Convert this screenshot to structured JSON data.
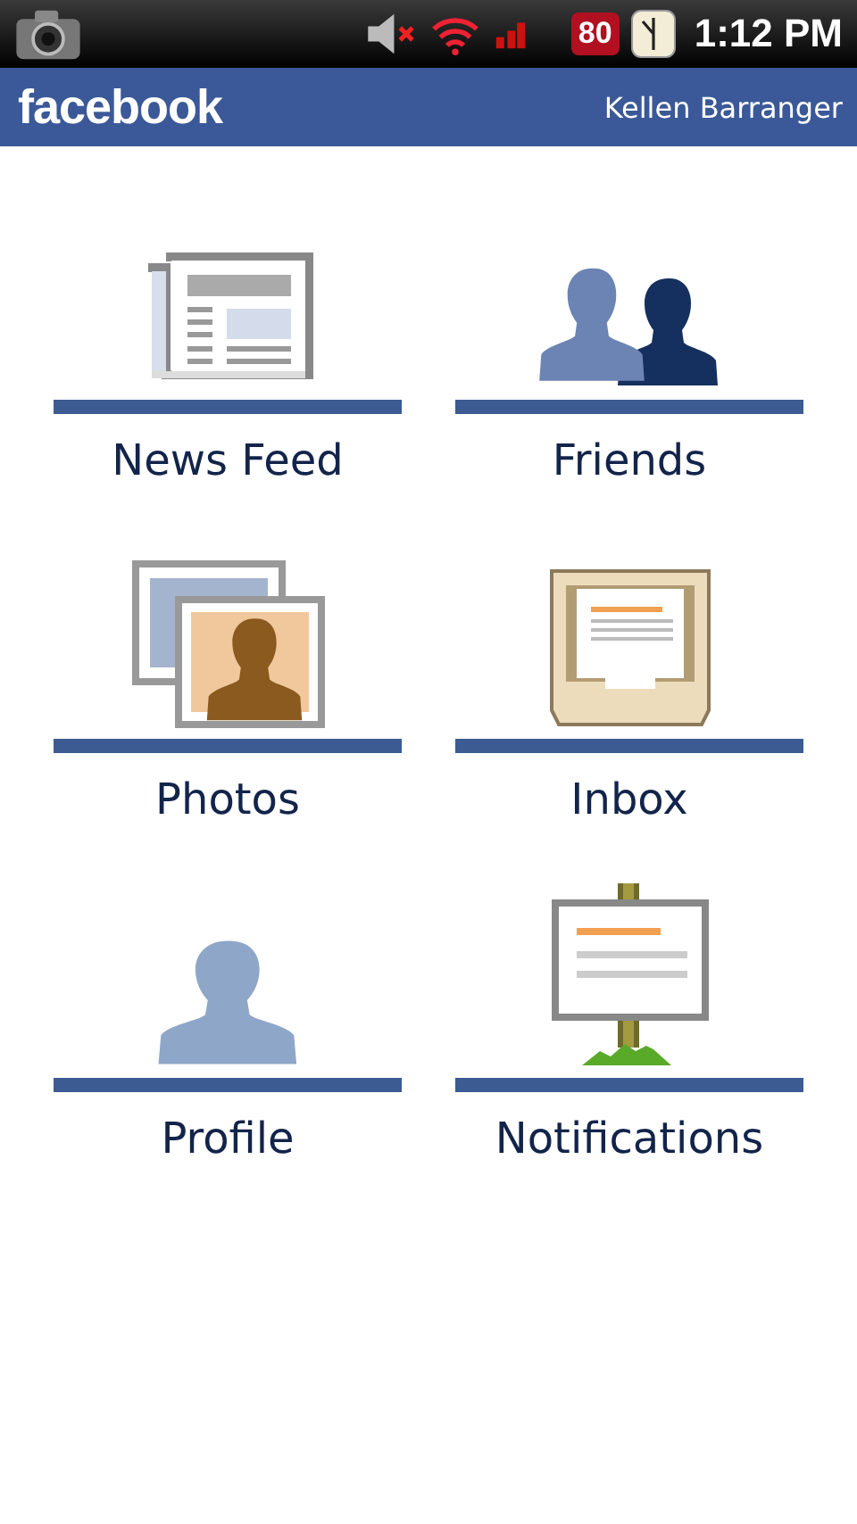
{
  "status_bar": {
    "battery": "80",
    "time": "1:12 PM"
  },
  "header": {
    "logo": "facebook",
    "user": "Kellen Barranger"
  },
  "tiles": [
    {
      "kind": "newsfeed",
      "label": "News Feed"
    },
    {
      "kind": "friends",
      "label": "Friends"
    },
    {
      "kind": "photos",
      "label": "Photos"
    },
    {
      "kind": "inbox",
      "label": "Inbox"
    },
    {
      "kind": "profile",
      "label": "Profile"
    },
    {
      "kind": "notifications",
      "label": "Notifications"
    }
  ]
}
